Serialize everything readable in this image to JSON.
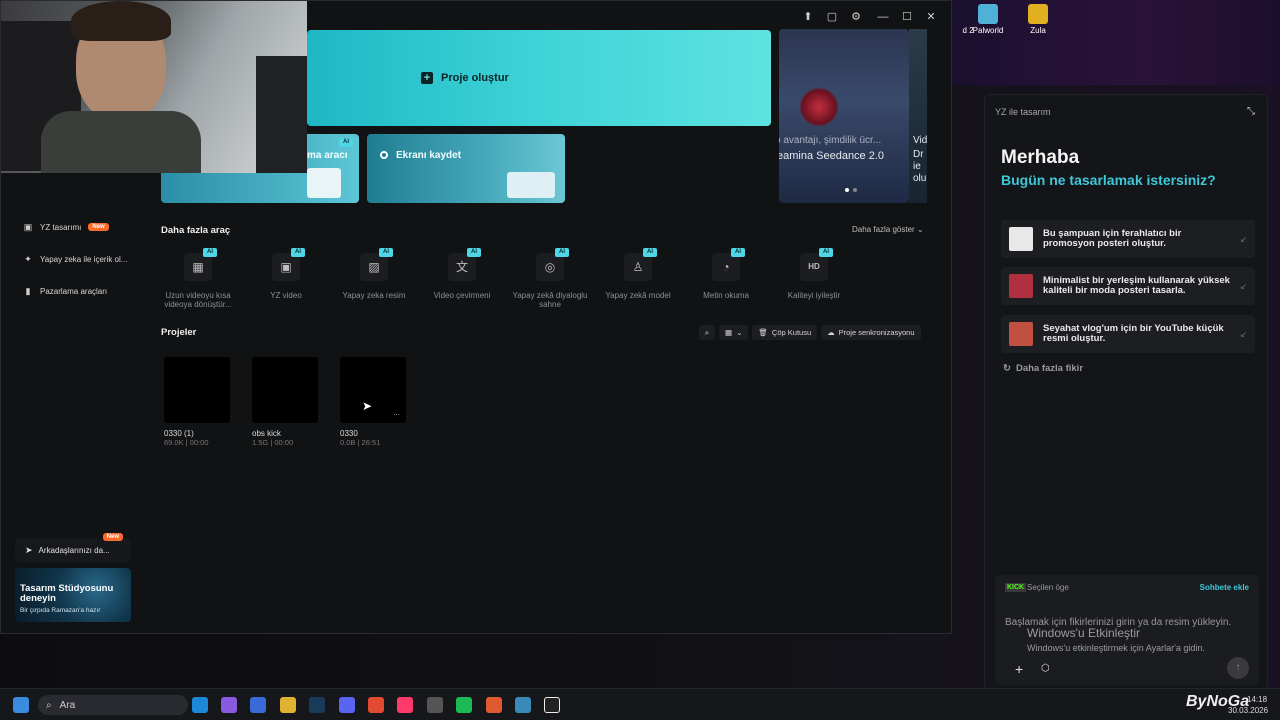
{
  "desktop": {
    "icons": [
      {
        "label": "d 2",
        "color": "#2a1a3a"
      },
      {
        "label": "Palworld",
        "color": "#4fb0d8"
      },
      {
        "label": "Zula",
        "color": "#e0b020"
      }
    ],
    "watermark_title": "Windows'u Etkinleştir",
    "watermark_sub": "Windows'u etkinleştirmek için Ayarlar'a gidin."
  },
  "app": {
    "create_project": "Proje oluştur",
    "card1_label": "ma aracı",
    "card2_label": "Ekranı kaydet",
    "banner_line1": "o avantajı, şimdilik ücr...",
    "banner_line2": "eamina Seedance 2.0",
    "banner_tail_1": "Vid",
    "banner_tail_2": "Dr",
    "banner_tail_3": "ie",
    "banner_tail_4": "olu",
    "ai_badge": "AI",
    "more_tools_title": "Daha fazla araç",
    "show_more": "Daha fazla göster",
    "tools": [
      {
        "icon": "▦",
        "label": "Uzun videoyu kısa videoya dönüştür..."
      },
      {
        "icon": "▣",
        "label": "YZ video"
      },
      {
        "icon": "▨",
        "label": "Yapay zeka resim"
      },
      {
        "icon": "文",
        "label": "Video çevirmeni"
      },
      {
        "icon": "◎",
        "label": "Yapay zekâ diyaloglu sahne"
      },
      {
        "icon": "♙",
        "label": "Yapay zekâ model"
      },
      {
        "icon": "◔",
        "label": "Metin okuma"
      },
      {
        "icon": "HD",
        "label": "Kaliteyi iyileştir"
      }
    ],
    "projects_title": "Projeler",
    "trash_label": "Çöp Kutusu",
    "sync_label": "Proje senkronizasyonu",
    "projects": [
      {
        "name": "0330 (1)",
        "meta": "69.0K | 00:00"
      },
      {
        "name": "obs kick",
        "meta": "1.5G | 00:00"
      },
      {
        "name": "0330",
        "meta": "0.0B | 26:51"
      }
    ],
    "project_more": "...",
    "sidebar": [
      {
        "label": "YZ tasarımı",
        "badge": "New"
      },
      {
        "label": "Yapay zeka ile içerik ol..."
      },
      {
        "label": "Pazarlama araçları"
      }
    ],
    "invite_label": "Arkadaşlarınızı da...",
    "invite_badge": "New",
    "promo_title": "Tasarım Stüdyosunu deneyin",
    "promo_sub": "Bir çırpıda Ramazan'a hazır"
  },
  "design_panel": {
    "header": "YZ ile tasarım",
    "greeting": "Merhaba",
    "question": "Bugün ne tasarlamak istersiniz?",
    "suggestions": [
      {
        "text": "Bu şampuan için ferahlatıcı bir promosyon posteri oluştur.",
        "color": "#e8e8e8"
      },
      {
        "text": "Minimalist bir yerleşim kullanarak yüksek kaliteli bir moda posteri tasarla.",
        "color": "#b03040"
      },
      {
        "text": "Seyahat vlog'um için bir YouTube küçük resmi oluştur.",
        "color": "#c05040"
      }
    ],
    "more_ideas": "Daha fazla fikir",
    "selected_logo": "KICK",
    "selected_label": "Seçilen öge",
    "add_to_chat": "Sohbete ekle",
    "input_placeholder": "Başlamak için fikirlerinizi girin ya da resim yükleyin."
  },
  "taskbar": {
    "search_label": "Ara",
    "time": "14:18",
    "date": "30.03.2026",
    "brand": "ByNoGa"
  },
  "colors": {
    "accent": "#3ed3d8",
    "panel_accent": "#3ec8d8",
    "new_badge": "#ff6a2b"
  }
}
